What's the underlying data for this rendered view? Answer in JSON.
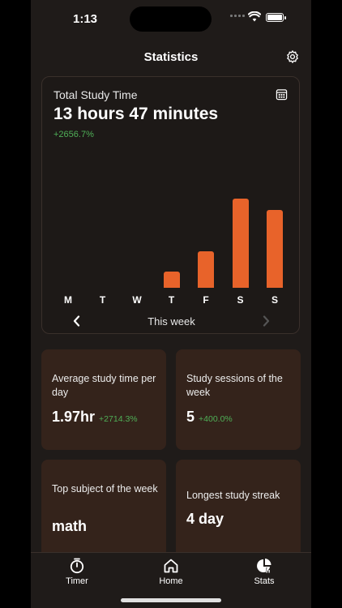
{
  "status": {
    "time": "1:13"
  },
  "header": {
    "title": "Statistics"
  },
  "total": {
    "label": "Total Study Time",
    "value": "13 hours 47 minutes",
    "change": "+2656.7%"
  },
  "chart_data": {
    "type": "bar",
    "categories": [
      "M",
      "T",
      "W",
      "T",
      "F",
      "S",
      "S"
    ],
    "values": [
      0,
      0,
      0,
      19,
      43,
      105,
      92
    ],
    "ylim": [
      0,
      110
    ]
  },
  "week_nav": {
    "label": "This week"
  },
  "tiles": [
    {
      "label": "Average study time per day",
      "value": "1.97hr",
      "change": "+2714.3%"
    },
    {
      "label": "Study sessions of the week",
      "value": "5",
      "change": "+400.0%"
    },
    {
      "label": "Top subject of the week",
      "value": "math"
    },
    {
      "label": "Longest study streak",
      "value": "4 day"
    }
  ],
  "tabs": [
    {
      "label": "Timer",
      "icon": "timer-icon"
    },
    {
      "label": "Home",
      "icon": "home-icon"
    },
    {
      "label": "Stats",
      "icon": "stats-icon"
    }
  ],
  "colors": {
    "accent": "#e8632a",
    "positive": "#4faf57",
    "tile_bg": "#34231b"
  }
}
